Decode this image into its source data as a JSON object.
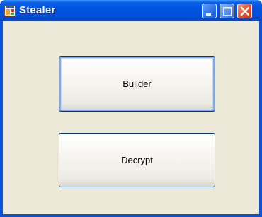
{
  "window": {
    "title": "Stealer",
    "icon": "app-window-icon",
    "controls": [
      "minimize-icon",
      "maximize-icon",
      "close-icon"
    ],
    "colors": {
      "titlebar": "#0054e3",
      "client": "#ece9d8",
      "close": "#e2502a",
      "button_border": "#003c74"
    }
  },
  "buttons": {
    "builder_label": "Builder",
    "decrypt_label": "Decrypt"
  }
}
